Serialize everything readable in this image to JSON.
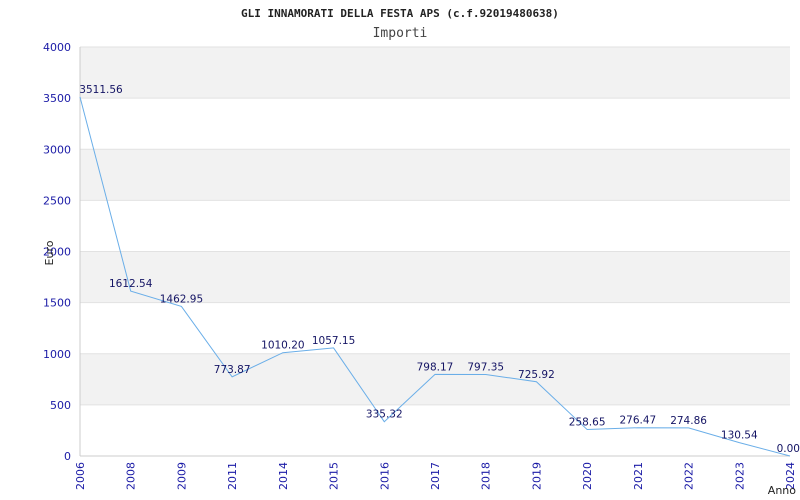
{
  "chart_data": {
    "type": "line",
    "title": "GLI INNAMORATI DELLA FESTA APS (c.f.92019480638)",
    "subtitle": "Importi",
    "xlabel": "Anno",
    "ylabel": "Euro",
    "x": [
      "2006",
      "2008",
      "2009",
      "2011",
      "2014",
      "2015",
      "2016",
      "2017",
      "2018",
      "2019",
      "2020",
      "2021",
      "2022",
      "2023",
      "2024"
    ],
    "series": [
      {
        "values": [
          3511.56,
          1612.54,
          1462.95,
          773.87,
          1010.2,
          1057.15,
          335.32,
          798.17,
          797.35,
          725.92,
          258.65,
          276.47,
          274.86,
          130.54,
          0.0
        ],
        "labels": [
          "3511.56",
          "1612.54",
          "1462.95",
          "773.87",
          "1010.20",
          "1057.15",
          "335.32",
          "798.17",
          "797.35",
          "725.92",
          "258.65",
          "276.47",
          "274.86",
          "130.54",
          "0.00"
        ],
        "color": "#6aaee8"
      }
    ],
    "ylim": [
      0,
      4000
    ],
    "yticks": [
      0,
      500,
      1000,
      1500,
      2000,
      2500,
      3000,
      3500,
      4000
    ],
    "grid": true,
    "band_color": "#f2f2f2",
    "gridline_color": "#e2e2e2",
    "tick_color": "#1a1aa6"
  }
}
